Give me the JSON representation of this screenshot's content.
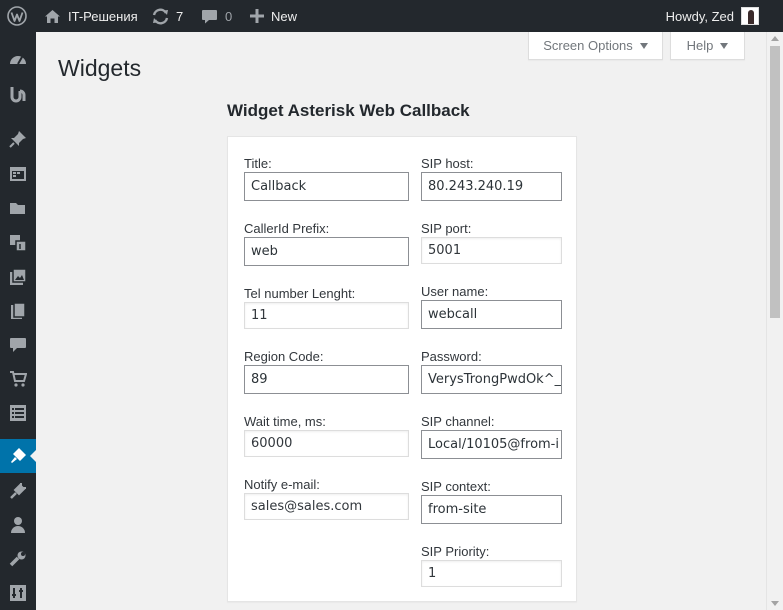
{
  "adminbar": {
    "site_name": "IT-Решения",
    "updates_count": "7",
    "comments_count": "0",
    "new_label": "New",
    "howdy": "Howdy, Zed"
  },
  "screen_meta": {
    "screen_options": "Screen Options",
    "help": "Help"
  },
  "page": {
    "title": "Widgets"
  },
  "widget": {
    "title": "Widget Asterisk Web Callback",
    "left_fields": [
      {
        "label": "Title:",
        "value": "Callback"
      },
      {
        "label": "CallerId Prefix:",
        "value": "web"
      },
      {
        "label": "Tel number Lenght:",
        "value": "11"
      },
      {
        "label": "Region Code:",
        "value": "89"
      },
      {
        "label": "Wait time, ms:",
        "value": "60000"
      },
      {
        "label": "Notify e-mail:",
        "value": "sales@sales.com"
      }
    ],
    "right_fields": [
      {
        "label": "SIP host:",
        "value": "80.243.240.19"
      },
      {
        "label": "SIP port:",
        "value": "5001"
      },
      {
        "label": "User name:",
        "value": "webcall"
      },
      {
        "label": "Password:",
        "value": "VerysTrongPwdOk^_"
      },
      {
        "label": "SIP channel:",
        "value": "Local/10105@from-i"
      },
      {
        "label": "SIP context:",
        "value": "from-site"
      },
      {
        "label": "SIP Priority:",
        "value": "1"
      }
    ]
  },
  "sidebar": {
    "icons": [
      "dashboard-icon",
      "logo-icon",
      "pin-icon",
      "calendar-icon",
      "folder-icon",
      "media-icon",
      "gallery-icon",
      "pages-icon",
      "comments-icon",
      "cart-icon",
      "list-icon",
      "appearance-icon",
      "plugins-icon",
      "users-icon",
      "tools-icon",
      "settings-icon"
    ],
    "active": "appearance-icon"
  },
  "colors": {
    "adminbar_bg": "#23282d",
    "active_menu": "#0073aa",
    "page_bg": "#f1f1f1"
  }
}
